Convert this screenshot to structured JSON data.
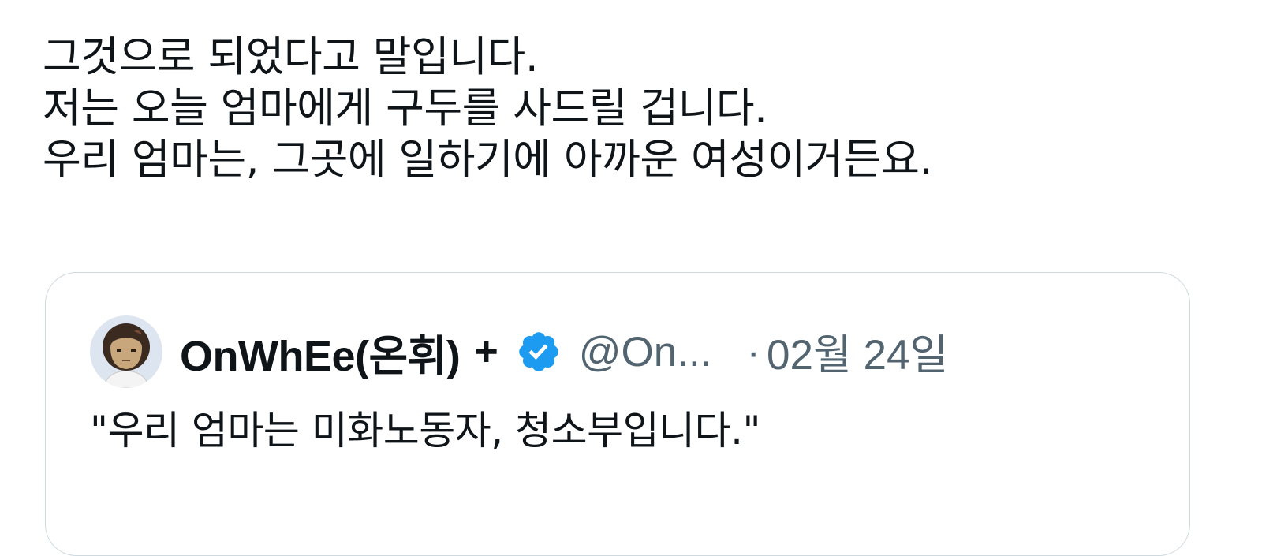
{
  "tweet": {
    "lines": [
      "그것으로 되었다고 말입니다.",
      "저는 오늘 엄마에게 구두를 사드릴 겁니다.",
      "우리 엄마는, 그곳에 일하기에 아까운 여성이거든요."
    ]
  },
  "quoted_tweet": {
    "avatar_icon": "cartoon-avatar",
    "display_name": "OnWhEe(온휘)",
    "plus": "+",
    "verified_icon": "verified-badge-icon",
    "handle": "@On...",
    "separator": "·",
    "date": "02월 24일",
    "text": "\"우리 엄마는 미화노동자, 청소부입니다.\""
  },
  "colors": {
    "text_primary": "#0f1419",
    "text_secondary": "#536471",
    "border": "#cfd9de",
    "verified_blue": "#1d9bf0"
  }
}
